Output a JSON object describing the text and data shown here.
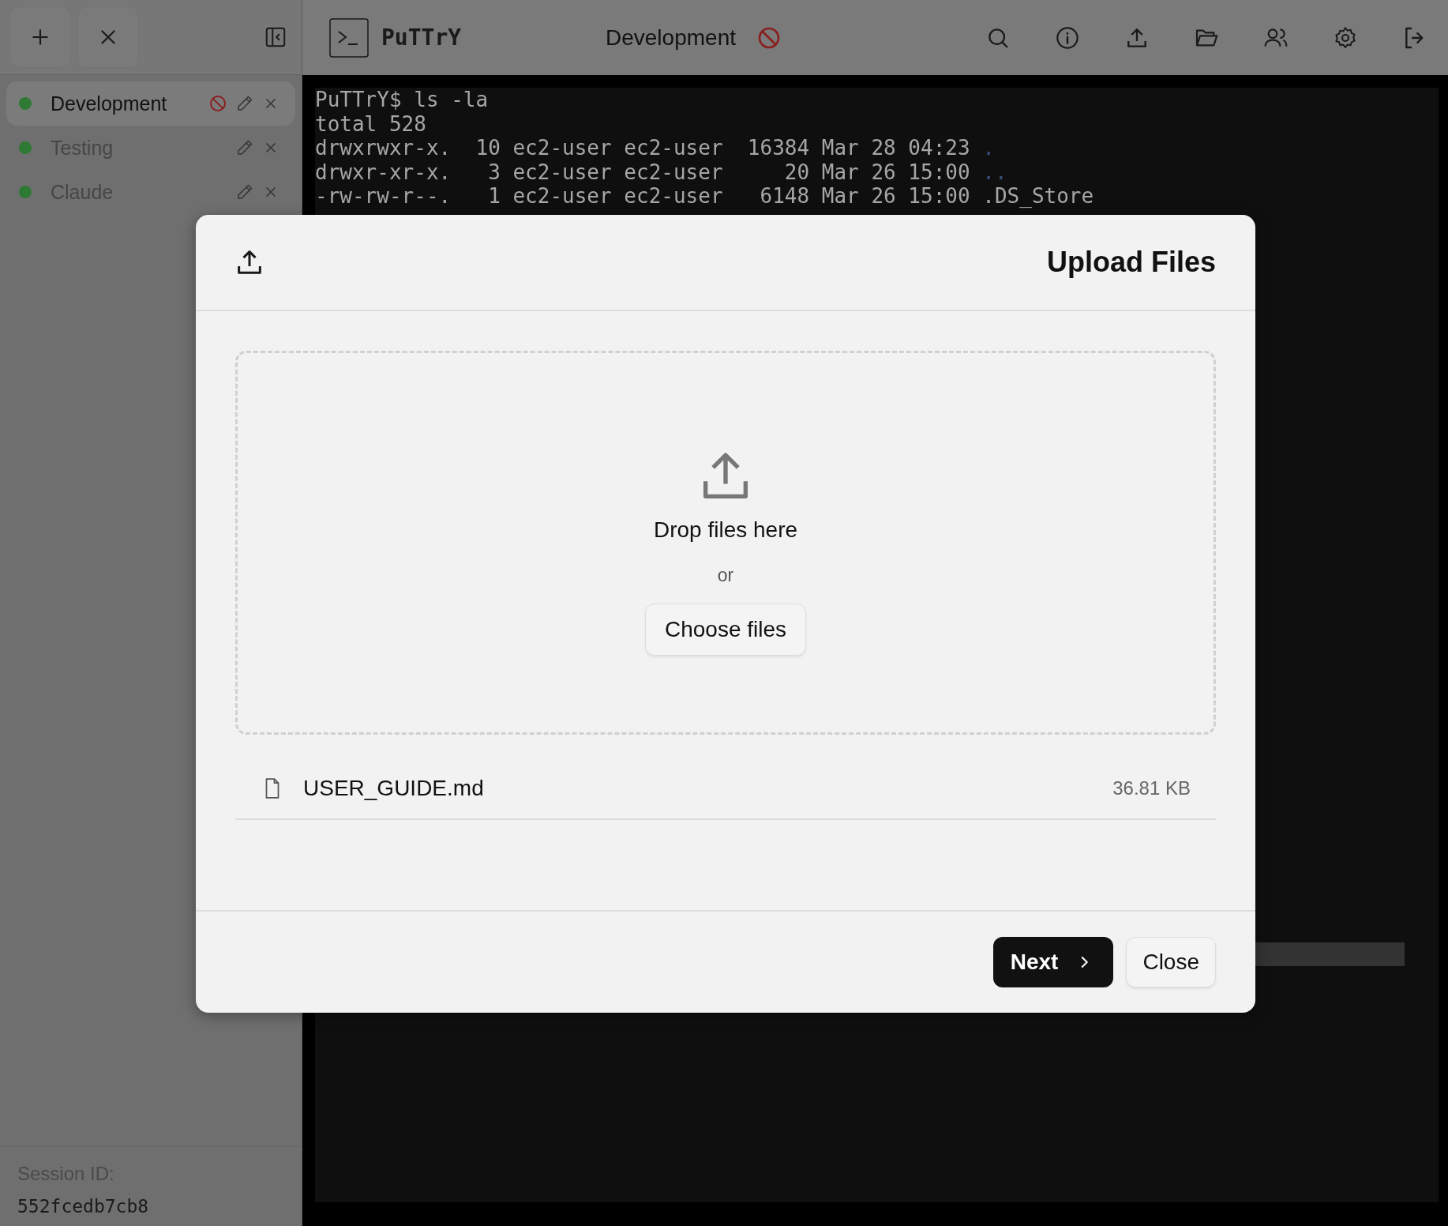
{
  "sidebar": {
    "sessions": [
      {
        "name": "Development",
        "color": "#2e7a34",
        "selected": true,
        "blocked": true
      },
      {
        "name": "Testing",
        "color": "#2e7a34",
        "selected": false,
        "blocked": false
      },
      {
        "name": "Claude",
        "color": "#2e7a34",
        "selected": false,
        "blocked": false
      }
    ],
    "session_id": {
      "label": "Session ID:",
      "value": "552fcedb7cb8"
    }
  },
  "header": {
    "app_name": "PuTTrY",
    "session_title": "Development",
    "blocked": true
  },
  "terminal": {
    "lines": [
      {
        "text": "PuTTrY$ ls -la"
      },
      {
        "text": "total 528"
      },
      {
        "text": "drwxrwxr-x.  10 ec2-user ec2-user  16384 Mar 28 04:23 ",
        "entry": ".",
        "kind": "dir"
      },
      {
        "text": "drwxr-xr-x.   3 ec2-user ec2-user     20 Mar 26 15:00 ",
        "entry": "..",
        "kind": "dir"
      },
      {
        "text": "-rw-rw-r--.   1 ec2-user ec2-user   6148 Mar 26 15:00 ",
        "entry": ".DS_Store",
        "kind": "file"
      }
    ]
  },
  "upload_dialog": {
    "title": "Upload Files",
    "drop_text": "Drop files here",
    "or_text": "or",
    "choose_button": "Choose files",
    "files": [
      {
        "name": "USER_GUIDE.md",
        "size": "36.81 KB"
      }
    ],
    "next_button": "Next",
    "close_button": "Close"
  }
}
